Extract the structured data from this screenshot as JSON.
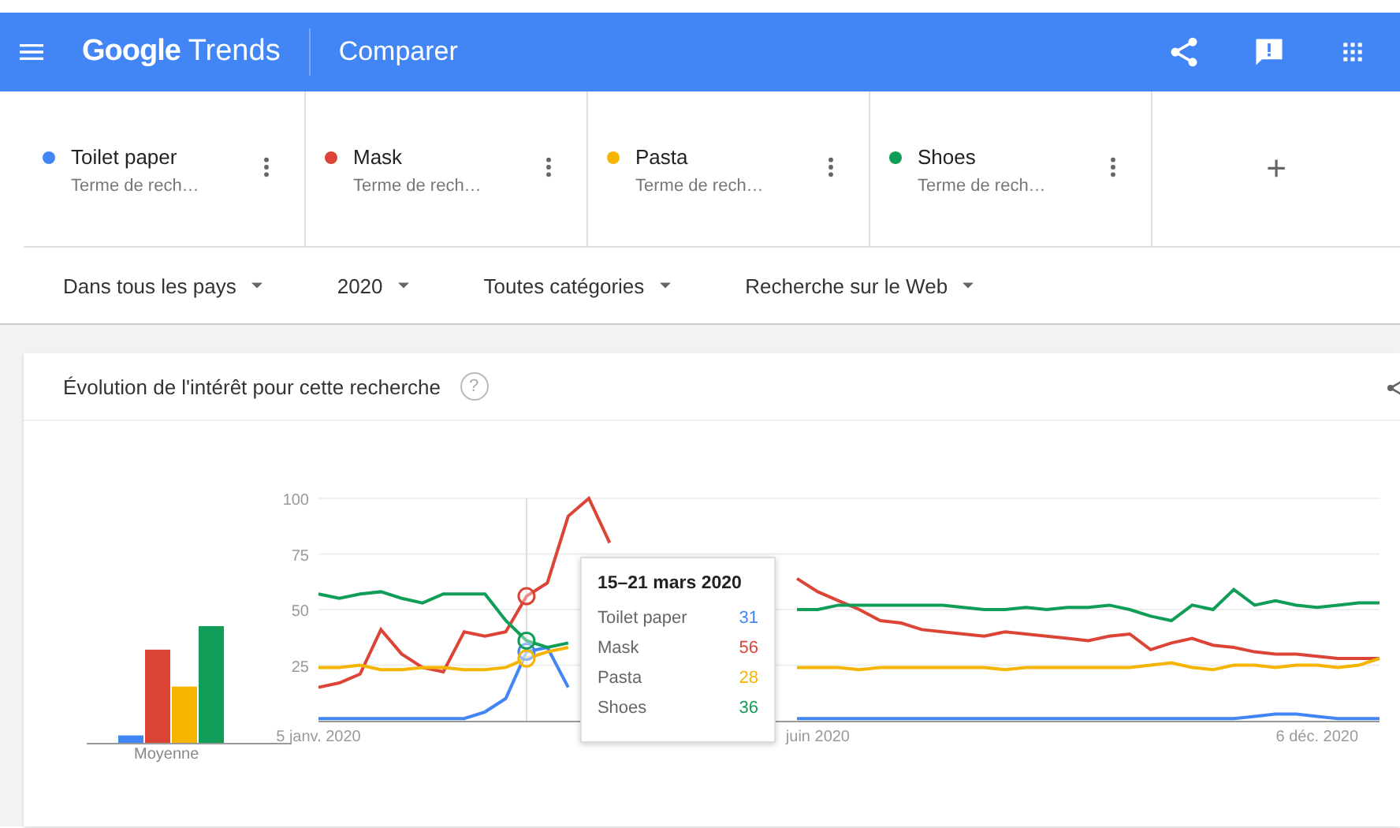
{
  "header": {
    "logo_bold": "Google",
    "logo_text": "Trends",
    "title": "Comparer"
  },
  "terms": [
    {
      "name": "Toilet paper",
      "subtitle": "Terme de rech…",
      "color": "#4285f4"
    },
    {
      "name": "Mask",
      "subtitle": "Terme de rech…",
      "color": "#db4437"
    },
    {
      "name": "Pasta",
      "subtitle": "Terme de rech…",
      "color": "#f4b400"
    },
    {
      "name": "Shoes",
      "subtitle": "Terme de rech…",
      "color": "#0f9d58"
    }
  ],
  "add_term": "+",
  "filters": [
    {
      "label": "Dans tous les pays"
    },
    {
      "label": "2020"
    },
    {
      "label": "Toutes catégories"
    },
    {
      "label": "Recherche sur le Web"
    }
  ],
  "interest": {
    "title": "Évolution de l'intérêt pour cette recherche",
    "help": "?",
    "average_label": "Moyenne",
    "tooltip": {
      "title": "15–21 mars 2020",
      "values": [
        "31",
        "56",
        "28",
        "36"
      ]
    },
    "chart_data": {
      "type": "line",
      "grid": true,
      "ylim": [
        0,
        100
      ],
      "yticks": [
        25,
        50,
        75,
        100
      ],
      "categories": [
        "5 janv. 2020",
        null,
        null,
        null,
        null,
        null,
        null,
        null,
        null,
        null,
        null,
        null,
        null,
        null,
        null,
        null,
        null,
        null,
        null,
        null,
        null,
        null,
        null,
        null,
        "juin 2020",
        null,
        null,
        null,
        null,
        null,
        null,
        null,
        null,
        null,
        null,
        null,
        null,
        null,
        null,
        null,
        null,
        null,
        null,
        null,
        null,
        null,
        null,
        null,
        "6 déc. 2020",
        null,
        null,
        null
      ],
      "series": [
        {
          "name": "Toilet paper",
          "color": "#4285f4",
          "values": [
            1,
            1,
            1,
            1,
            1,
            1,
            1,
            1,
            4,
            10,
            31,
            33,
            15,
            null,
            null,
            null,
            null,
            null,
            null,
            null,
            null,
            null,
            null,
            1,
            1,
            1,
            1,
            1,
            1,
            1,
            1,
            1,
            1,
            1,
            1,
            1,
            1,
            1,
            1,
            1,
            1,
            1,
            1,
            1,
            1,
            2,
            3,
            3,
            2,
            1,
            1,
            1
          ]
        },
        {
          "name": "Mask",
          "color": "#db4437",
          "values": [
            15,
            17,
            21,
            41,
            30,
            24,
            22,
            40,
            38,
            40,
            56,
            62,
            92,
            100,
            80,
            null,
            null,
            null,
            null,
            null,
            null,
            null,
            null,
            64,
            58,
            54,
            50,
            45,
            44,
            41,
            40,
            39,
            38,
            40,
            39,
            38,
            37,
            36,
            38,
            39,
            32,
            35,
            37,
            34,
            33,
            31,
            30,
            30,
            29,
            28,
            28,
            28
          ]
        },
        {
          "name": "Pasta",
          "color": "#f4b400",
          "values": [
            24,
            24,
            25,
            23,
            23,
            24,
            24,
            23,
            23,
            24,
            28,
            31,
            33,
            null,
            null,
            null,
            null,
            null,
            null,
            null,
            null,
            null,
            null,
            24,
            24,
            24,
            23,
            24,
            24,
            24,
            24,
            24,
            24,
            23,
            24,
            24,
            24,
            24,
            24,
            24,
            25,
            26,
            24,
            23,
            25,
            25,
            24,
            25,
            25,
            24,
            25,
            28
          ]
        },
        {
          "name": "Shoes",
          "color": "#0f9d58",
          "values": [
            57,
            55,
            57,
            58,
            55,
            53,
            57,
            57,
            57,
            45,
            36,
            33,
            35,
            null,
            null,
            null,
            null,
            null,
            null,
            null,
            null,
            null,
            null,
            50,
            50,
            52,
            52,
            52,
            52,
            52,
            52,
            51,
            50,
            50,
            51,
            50,
            51,
            51,
            52,
            50,
            47,
            45,
            52,
            50,
            59,
            52,
            54,
            52,
            51,
            52,
            53,
            53
          ]
        }
      ]
    }
  }
}
